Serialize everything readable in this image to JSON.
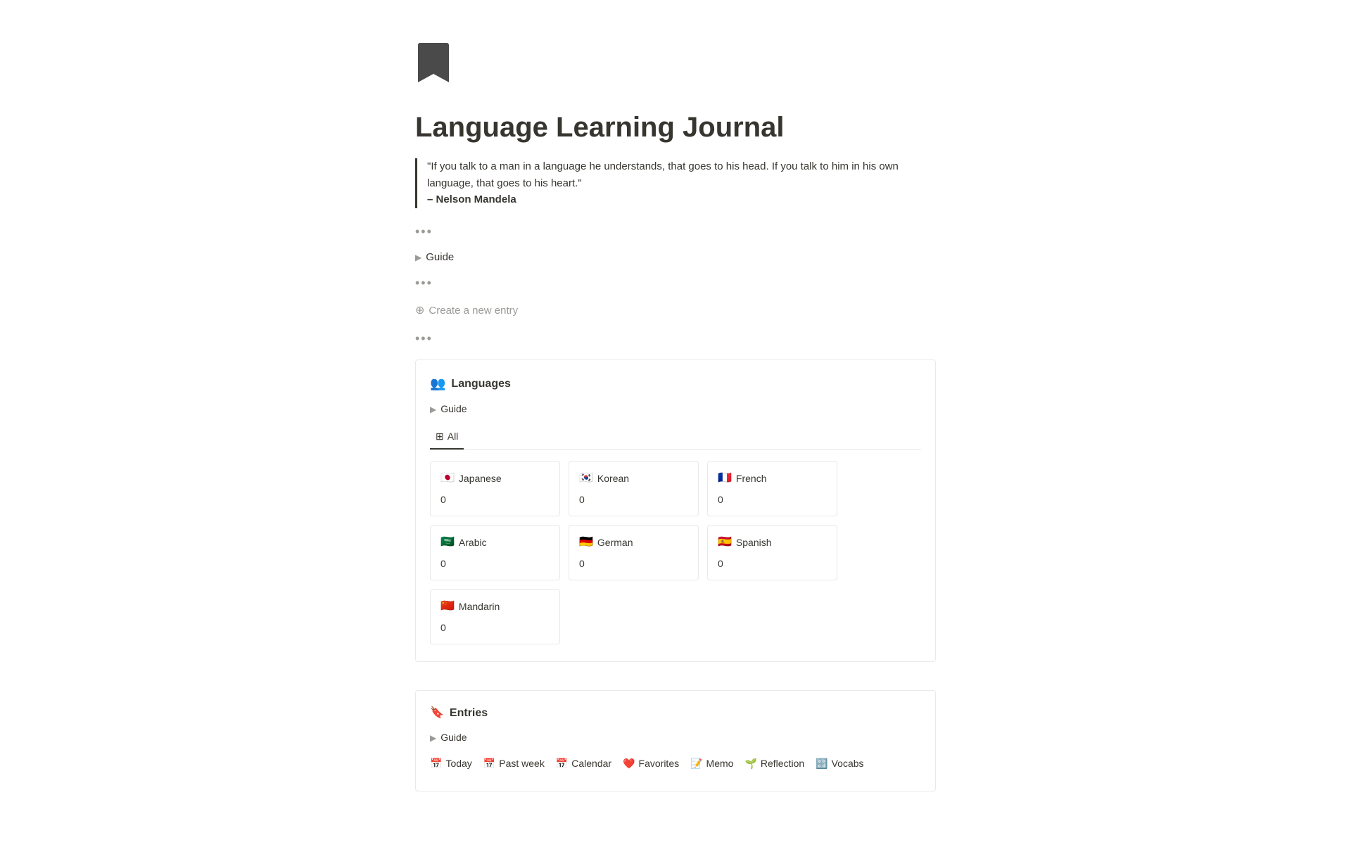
{
  "page": {
    "icon": "🔖",
    "title": "Language Learning Journal",
    "quote": {
      "text": "\"If you talk to a man in a language he understands, that goes to his head. If you talk to him in his own language, that goes to his heart.\"",
      "author": "– Nelson Mandela"
    }
  },
  "guide_toggle_label": "Guide",
  "create_entry_label": "Create a new entry",
  "languages_db": {
    "icon": "👥",
    "title": "Languages",
    "guide_label": "Guide",
    "tabs": [
      {
        "label": "All",
        "icon": "⊞",
        "active": true
      }
    ],
    "cards": [
      {
        "name": "Japanese",
        "flag": "🇯🇵",
        "count": "0"
      },
      {
        "name": "Korean",
        "flag": "🇰🇷",
        "count": "0"
      },
      {
        "name": "French",
        "flag": "🇫🇷",
        "count": "0"
      },
      {
        "name": "Arabic",
        "flag": "🇸🇦",
        "count": "0"
      },
      {
        "name": "German",
        "flag": "🇩🇪",
        "count": "0"
      },
      {
        "name": "Spanish",
        "flag": "🇪🇸",
        "count": "0"
      },
      {
        "name": "Mandarin",
        "flag": "🇨🇳",
        "count": "0"
      }
    ]
  },
  "entries_db": {
    "icon": "🔖",
    "title": "Entries",
    "guide_label": "Guide",
    "tabs": [
      {
        "label": "Today",
        "icon": "📅"
      },
      {
        "label": "Past week",
        "icon": "📅"
      },
      {
        "label": "Calendar",
        "icon": "📅"
      },
      {
        "label": "Favorites",
        "icon": "❤️"
      },
      {
        "label": "Memo",
        "icon": "📝"
      },
      {
        "label": "Reflection",
        "icon": "🌱"
      },
      {
        "label": "Vocabs",
        "icon": "🔡"
      }
    ]
  },
  "dots": "•••"
}
